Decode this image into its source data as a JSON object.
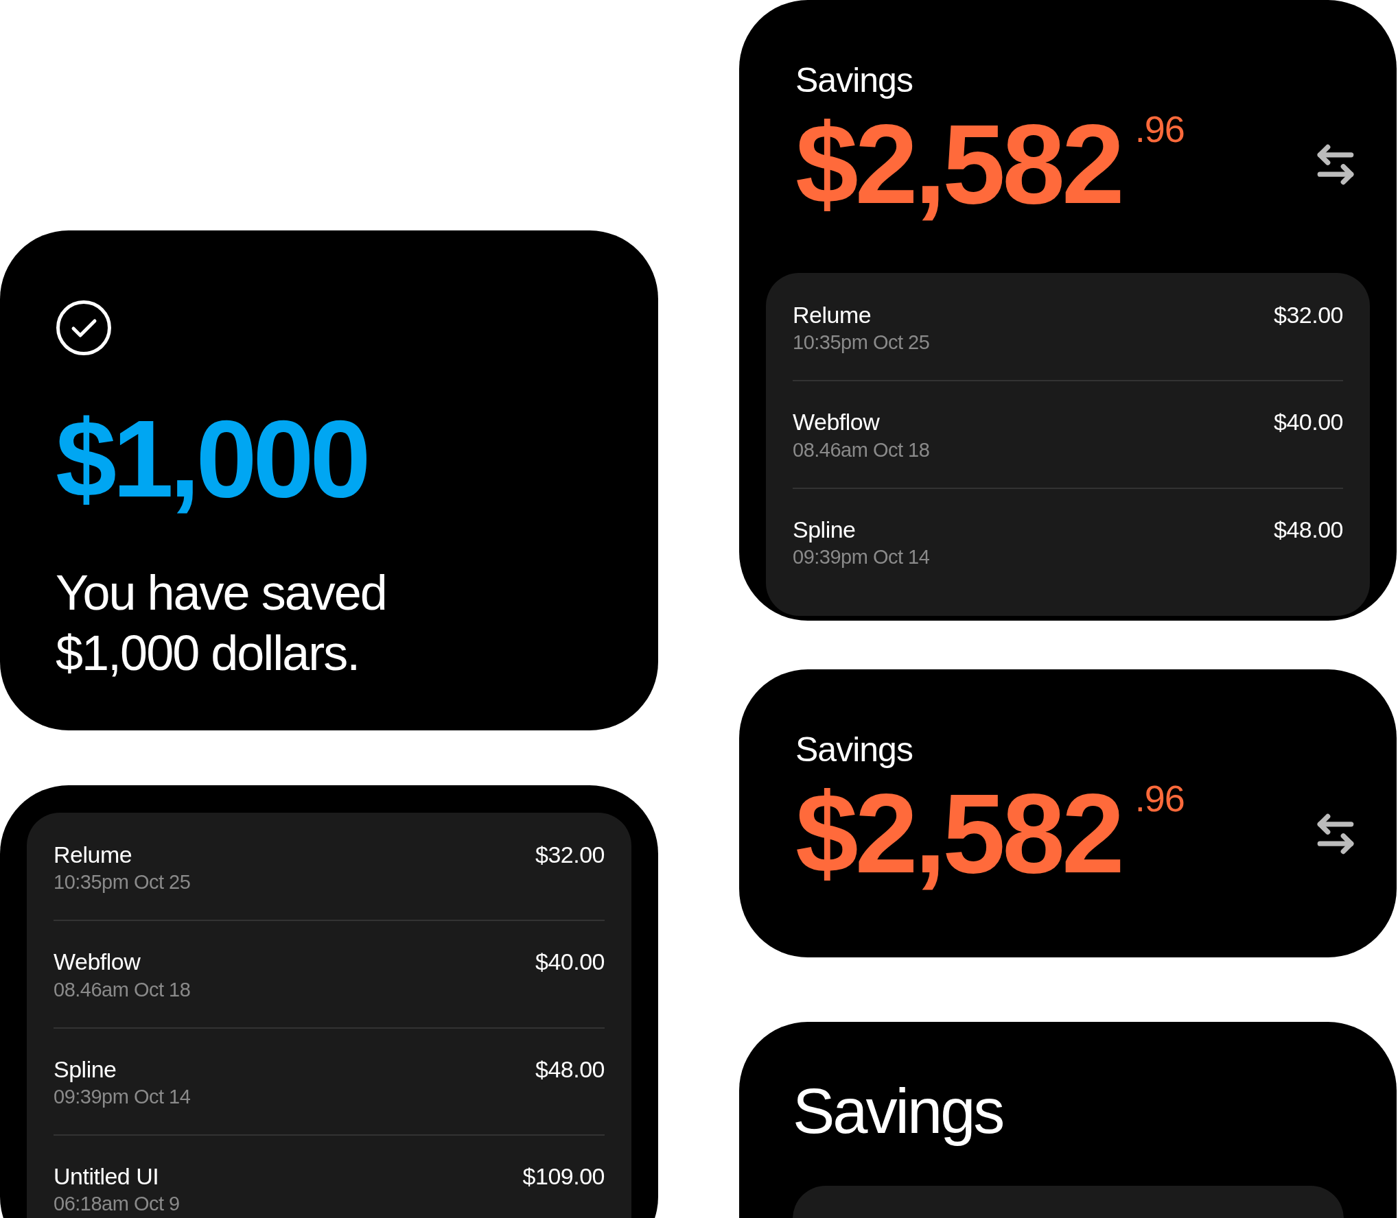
{
  "achievement_card": {
    "amount": "$1,000",
    "message": "You have saved $1,000 dollars."
  },
  "transactions_card": {
    "transactions": [
      {
        "name": "Relume",
        "time": "10:35pm Oct 25",
        "amount": "$32.00"
      },
      {
        "name": "Webflow",
        "time": "08.46am Oct 18",
        "amount": "$40.00"
      },
      {
        "name": "Spline",
        "time": "09:39pm Oct 14",
        "amount": "$48.00"
      },
      {
        "name": "Untitled UI",
        "time": "06:18am Oct 9",
        "amount": "$109.00"
      }
    ]
  },
  "savings_overview": {
    "label": "Savings",
    "whole": "$2,582",
    "cents": ".96",
    "transactions": [
      {
        "name": "Relume",
        "time": "10:35pm Oct 25",
        "amount": "$32.00"
      },
      {
        "name": "Webflow",
        "time": "08.46am Oct 18",
        "amount": "$40.00"
      },
      {
        "name": "Spline",
        "time": "09:39pm Oct 14",
        "amount": "$48.00"
      }
    ]
  },
  "savings_balance": {
    "label": "Savings",
    "whole": "$2,582",
    "cents": ".96"
  },
  "savings_header": {
    "title": "Savings"
  }
}
